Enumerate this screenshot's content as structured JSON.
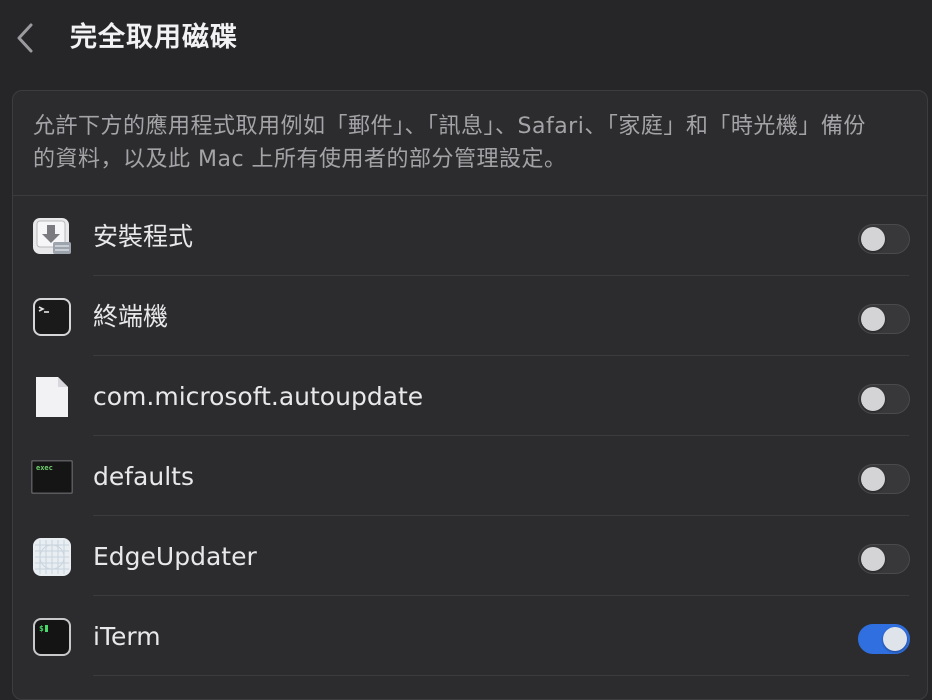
{
  "header": {
    "title": "完全取用磁碟"
  },
  "panel": {
    "description": "允許下方的應用程式取用例如「郵件」、「訊息」、Safari、「家庭」和「時光機」備份的資料，以及此 Mac 上所有使用者的部分管理設定。",
    "apps": [
      {
        "name": "安裝程式",
        "icon": "installer-icon",
        "enabled": false
      },
      {
        "name": "終端機",
        "icon": "terminal-icon",
        "enabled": false
      },
      {
        "name": "com.microsoft.autoupdate",
        "icon": "document-icon",
        "enabled": false
      },
      {
        "name": "defaults",
        "icon": "exec-icon",
        "enabled": false
      },
      {
        "name": "EdgeUpdater",
        "icon": "edgeupdater-icon",
        "enabled": false
      },
      {
        "name": "iTerm",
        "icon": "iterm-icon",
        "enabled": true
      }
    ]
  },
  "colors": {
    "background": "#262628",
    "panel": "#2c2c2e",
    "toggle_on": "#2f6fe0",
    "toggle_off": "#38383b"
  }
}
